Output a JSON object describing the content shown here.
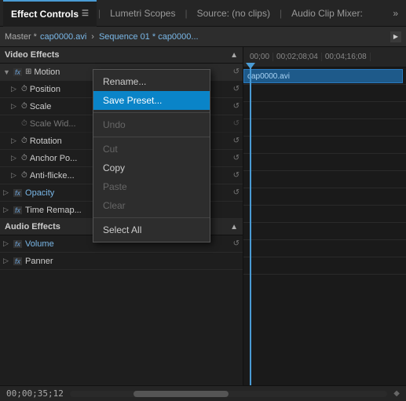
{
  "tabs": {
    "active": "Effect Controls",
    "inactive1": "Lumetri Scopes",
    "inactive2": "Source: (no clips)",
    "inactive3": "Audio Clip Mixer:"
  },
  "sequence": {
    "master_label": "Master *",
    "master_clip": "cap0000.avi",
    "arrow": "›",
    "seq_name": "Sequence 01 * cap0000..."
  },
  "video_effects": {
    "section_title": "Video Effects",
    "motion": {
      "name": "Motion",
      "position": "Position",
      "scale": "Scale",
      "scale_width": "Scale Wid...",
      "rotation": "Rotation",
      "anchor_point": "Anchor Po...",
      "anti_flicker": "Anti-flicke..."
    },
    "opacity": "Opacity",
    "time_remap": "Time Remap..."
  },
  "audio_effects": {
    "section_title": "Audio Effects",
    "volume": "Volume",
    "panner": "Panner"
  },
  "timeline": {
    "markers": [
      "00;00",
      "00;02;08;04",
      "00;04;16;08"
    ],
    "clip_name": "cap0000.avi"
  },
  "bottom": {
    "time": "00;00;35;12"
  },
  "context_menu": {
    "rename": "Rename...",
    "save_preset": "Save Preset...",
    "undo": "Undo",
    "cut": "Cut",
    "copy": "Copy",
    "paste": "Paste",
    "clear": "Clear",
    "select_all": "Select All"
  }
}
